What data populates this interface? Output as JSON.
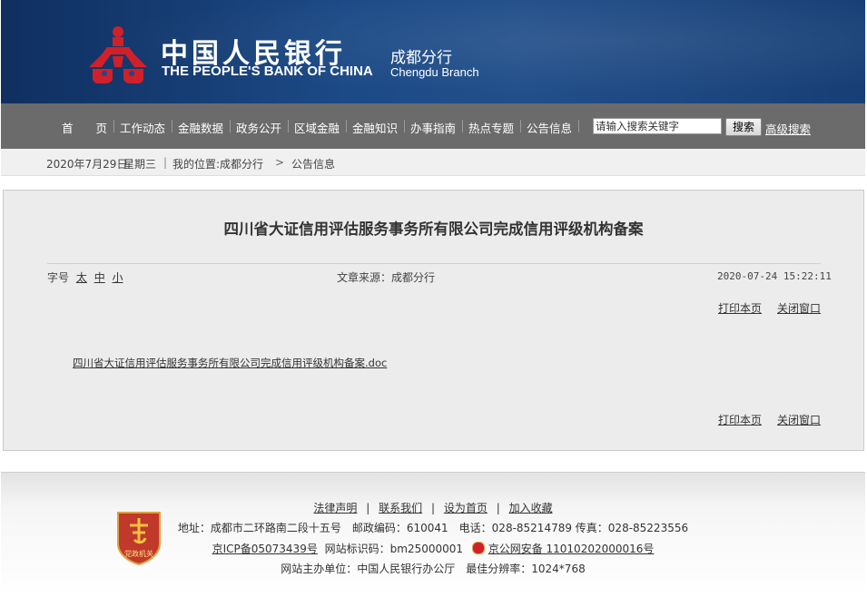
{
  "header": {
    "title_cn": "中国人民银行",
    "title_en": "THE PEOPLE'S BANK OF CHINA",
    "branch_cn": "成都分行",
    "branch_en": "Chengdu  Branch",
    "logo_icon": "pboc-logo-icon",
    "colors": {
      "header_bg": "#1c4a86",
      "nav_bg": "#6b6b6b",
      "logo_red": "#d0202a"
    }
  },
  "nav": {
    "items": [
      "首　　页",
      "工作动态",
      "金融数据",
      "政务公开",
      "区域金融",
      "金融知识",
      "办事指南",
      "热点专题",
      "公告信息"
    ],
    "search_placeholder": "请输入搜索关键字",
    "search_button": "搜索",
    "advanced_search": "高级搜索"
  },
  "breadcrumb": {
    "date": "2020年7月29日",
    "weekday": "星期三",
    "location_label": "我的位置:成都分行",
    "current": "公告信息"
  },
  "article": {
    "title": "四川省大证信用评估服务事务所有限公司完成信用评级机构备案",
    "font_label": "字号",
    "font_sizes": [
      "太",
      "中",
      "小"
    ],
    "source": "文章来源：成都分行",
    "datetime": "2020-07-24 15:22:11",
    "print": "打印本页",
    "close": "关闭窗口",
    "attachment": "四川省大证信用评估服务事务所有限公司完成信用评级机构备案.doc"
  },
  "footer": {
    "links": [
      "法律声明",
      "联系我们",
      "设为首页",
      "加入收藏"
    ],
    "address": "地址：成都市二环路南二段十五号　邮政编码：610041　电话：028-85214789 传真：028-85223556",
    "icp": "京ICP备05073439号",
    "site_code": "网站标识码：bm25000001",
    "police": "京公网安备 11010202000016号",
    "host": "网站主办单位：中国人民银行办公厅　最佳分辨率：1024*768",
    "badge_text": "党政机关",
    "badge_icon": "party-government-badge-icon",
    "police_icon": "police-emblem-icon"
  }
}
